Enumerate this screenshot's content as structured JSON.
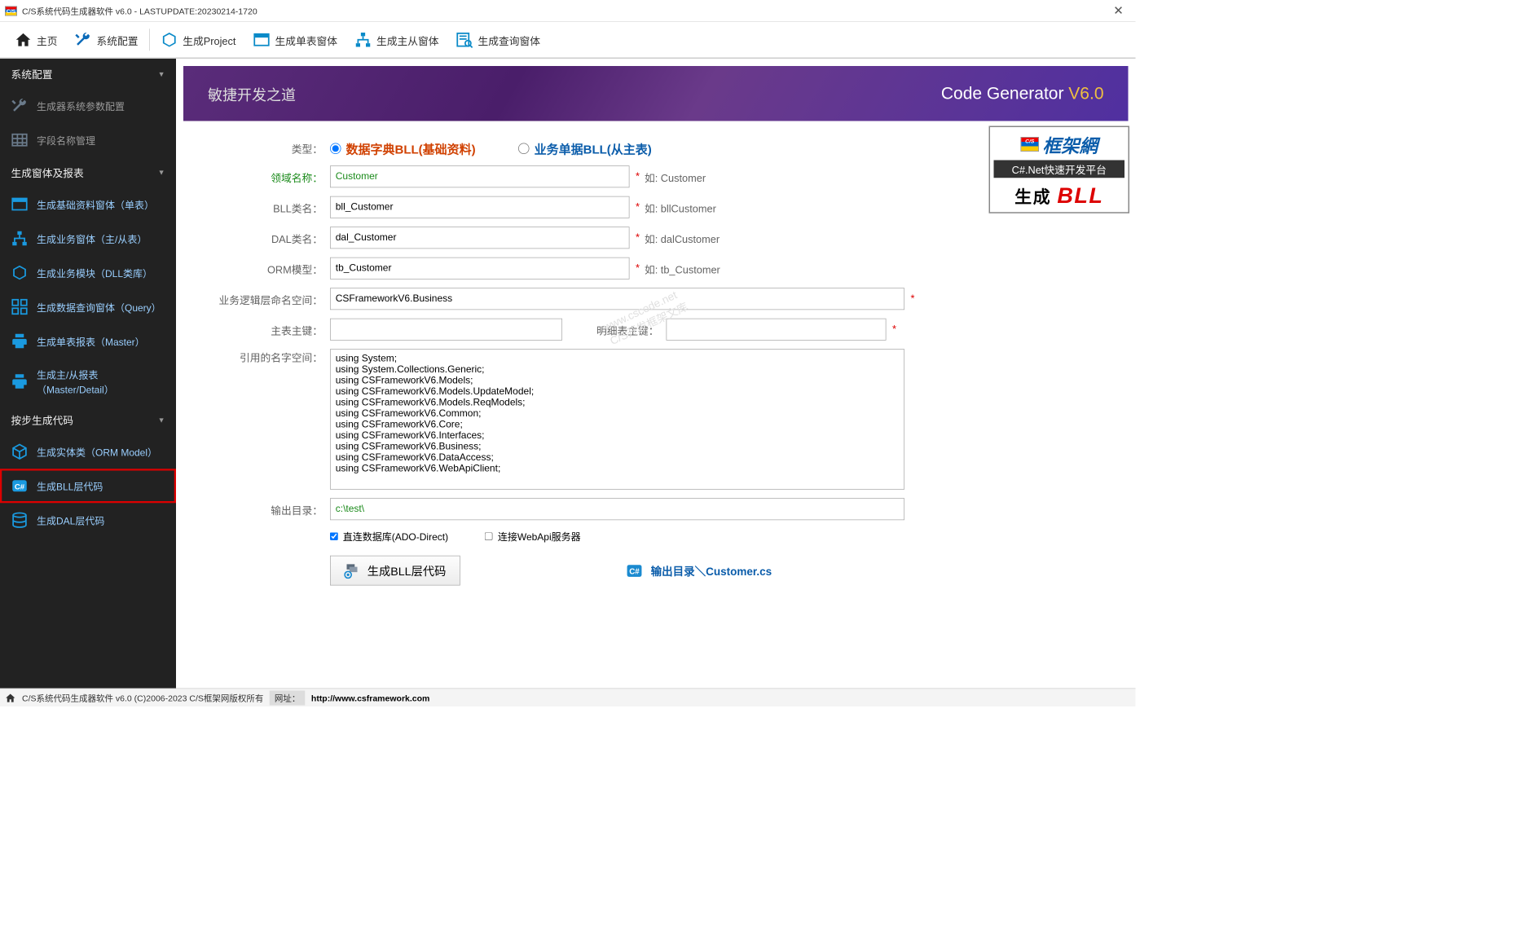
{
  "title": "C/S系统代码生成器软件 v6.0 - LASTUPDATE:20230214-1720",
  "toolbar": {
    "home": "主页",
    "config": "系统配置",
    "project": "生成Project",
    "single": "生成单表窗体",
    "master": "生成主从窗体",
    "query": "生成查询窗体"
  },
  "sidebar": {
    "s1": {
      "title": "系统配置",
      "items": [
        "生成器系统参数配置",
        "字段名称管理"
      ]
    },
    "s2": {
      "title": "生成窗体及报表",
      "items": [
        "生成基础资料窗体（单表）",
        "生成业务窗体（主/从表）",
        "生成业务模块（DLL类库）",
        "生成数据查询窗体（Query）",
        "生成单表报表（Master）",
        "生成主/从报表（Master/Detail）"
      ]
    },
    "s3": {
      "title": "按步生成代码",
      "items": [
        "生成实体类（ORM Model）",
        "生成BLL层代码",
        "生成DAL层代码"
      ]
    }
  },
  "banner": {
    "slogan": "敏捷开发之道",
    "brand1": "Code Generator ",
    "brand2": "V6.0"
  },
  "form": {
    "type_label": "类型：",
    "radio1": "数据字典BLL(基础资料)",
    "radio2": "业务单据BLL(从主表)",
    "domain_label": "领域名称：",
    "domain_value": "Customer",
    "domain_hint": "如: Customer",
    "bll_label": "BLL类名：",
    "bll_value": "bll_Customer",
    "bll_hint": "如: bllCustomer",
    "dal_label": "DAL类名：",
    "dal_value": "dal_Customer",
    "dal_hint": "如: dalCustomer",
    "orm_label": "ORM模型：",
    "orm_value": "tb_Customer",
    "orm_hint": "如: tb_Customer",
    "ns_label": "业务逻辑层命名空间：",
    "ns_value": "CSFrameworkV6.Business",
    "pk1_label": "主表主键：",
    "pk1_value": "",
    "pk2_label": "明细表主键：",
    "pk2_value": "",
    "refns_label": "引用的名字空间：",
    "refns_value": "using System;\nusing System.Collections.Generic;\nusing CSFrameworkV6.Models;\nusing CSFrameworkV6.Models.UpdateModel;\nusing CSFrameworkV6.Models.ReqModels;\nusing CSFrameworkV6.Common;\nusing CSFrameworkV6.Core;\nusing CSFrameworkV6.Interfaces;\nusing CSFrameworkV6.Business;\nusing CSFrameworkV6.DataAccess;\nusing CSFrameworkV6.WebApiClient;",
    "out_label": "输出目录：",
    "out_value": "c:\\test\\",
    "chk1": "直连数据库(ADO-Direct)",
    "chk2": "连接WebApi服务器",
    "genbtn": "生成BLL层代码",
    "link": "输出目录＼Customer.cs"
  },
  "badge": {
    "b1": "框架網",
    "b2": "C#.Net快速开发平台",
    "b3a": "生成 ",
    "b3b": "BLL"
  },
  "status": {
    "text": "C/S系统代码生成器软件 v6.0 (C)2006-2023 C/S框架网版权所有",
    "label": "网址：",
    "url": "http://www.csframework.com"
  }
}
